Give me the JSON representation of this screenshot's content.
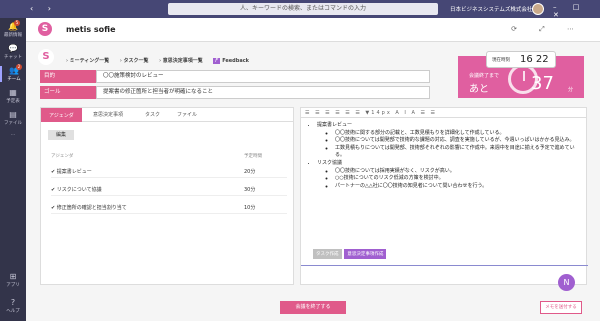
{
  "titlebar": {
    "search_placeholder": "人、キーワードの検索、またはコマンドの入力",
    "company": "日本ビジネスシステムズ株式会社"
  },
  "rail": {
    "items": [
      {
        "label": "最新情報",
        "badge": "5"
      },
      {
        "label": "チャット"
      },
      {
        "label": "チーム",
        "badge": "2"
      },
      {
        "label": "予定表"
      },
      {
        "label": "ファイル"
      },
      {
        "label": "..."
      }
    ],
    "bottom": [
      {
        "label": "アプリ"
      },
      {
        "label": "ヘルプ"
      }
    ]
  },
  "app": {
    "name": "metis sofie",
    "logo": "S"
  },
  "breadcrumb": [
    "ミーティング一覧",
    "タスク一覧",
    "意思決定事項一覧",
    "Feedback"
  ],
  "fields": [
    {
      "label": "目的",
      "value": "〇〇施策検討のレビュー"
    },
    {
      "label": "ゴール",
      "value": "提案書の修正箇所と担当者が明確になること"
    }
  ],
  "timer": {
    "now_label": "現在時刻",
    "now": "16 22",
    "remain_label": "会議終了まで",
    "remain_prefix": "あと",
    "remain": "37",
    "unit": "分"
  },
  "tabs": [
    "アジェンダ",
    "意思決定事項",
    "タスク",
    "ファイル"
  ],
  "edit_label": "編集",
  "agenda": {
    "col_name": "アジェンダ",
    "col_time": "予定時間",
    "rows": [
      {
        "name": "提案書レビュー",
        "time": "20分"
      },
      {
        "name": "リスクについて協議",
        "time": "30分"
      },
      {
        "name": "修正箇所の確認と担当割り当て",
        "time": "10分"
      }
    ]
  },
  "toolbar": {
    "fontsize": "14px"
  },
  "editor": {
    "b1": "提案書レビュー",
    "b1a": "〇〇技術に関する部分の記載と、工数見積もりを詳細化して作成している。",
    "b1b": "〇〇技術については開発部で技術的な課題の対応、調査を実施しているが、今週いっぱいはかかる見込み。",
    "b1c": "工数見積もりについては開発部、技術部それぞれの影響にて作成中。来週中を目途に揃える予定で進めている。",
    "b2": "リスク協議",
    "b2a": "〇〇技術については採用実績がなく、リスクが高い。",
    "b2b": "○○技術についてのリスク低減の方策を検討中。",
    "b2c": "パートナーの△△社に〇〇技術の知見者について問い合わせを行う。",
    "btn1": "タスク作成",
    "btn2": "意思決定事項作成"
  },
  "actions": {
    "end": "会議を終了する",
    "memo": "メモを送付する"
  }
}
